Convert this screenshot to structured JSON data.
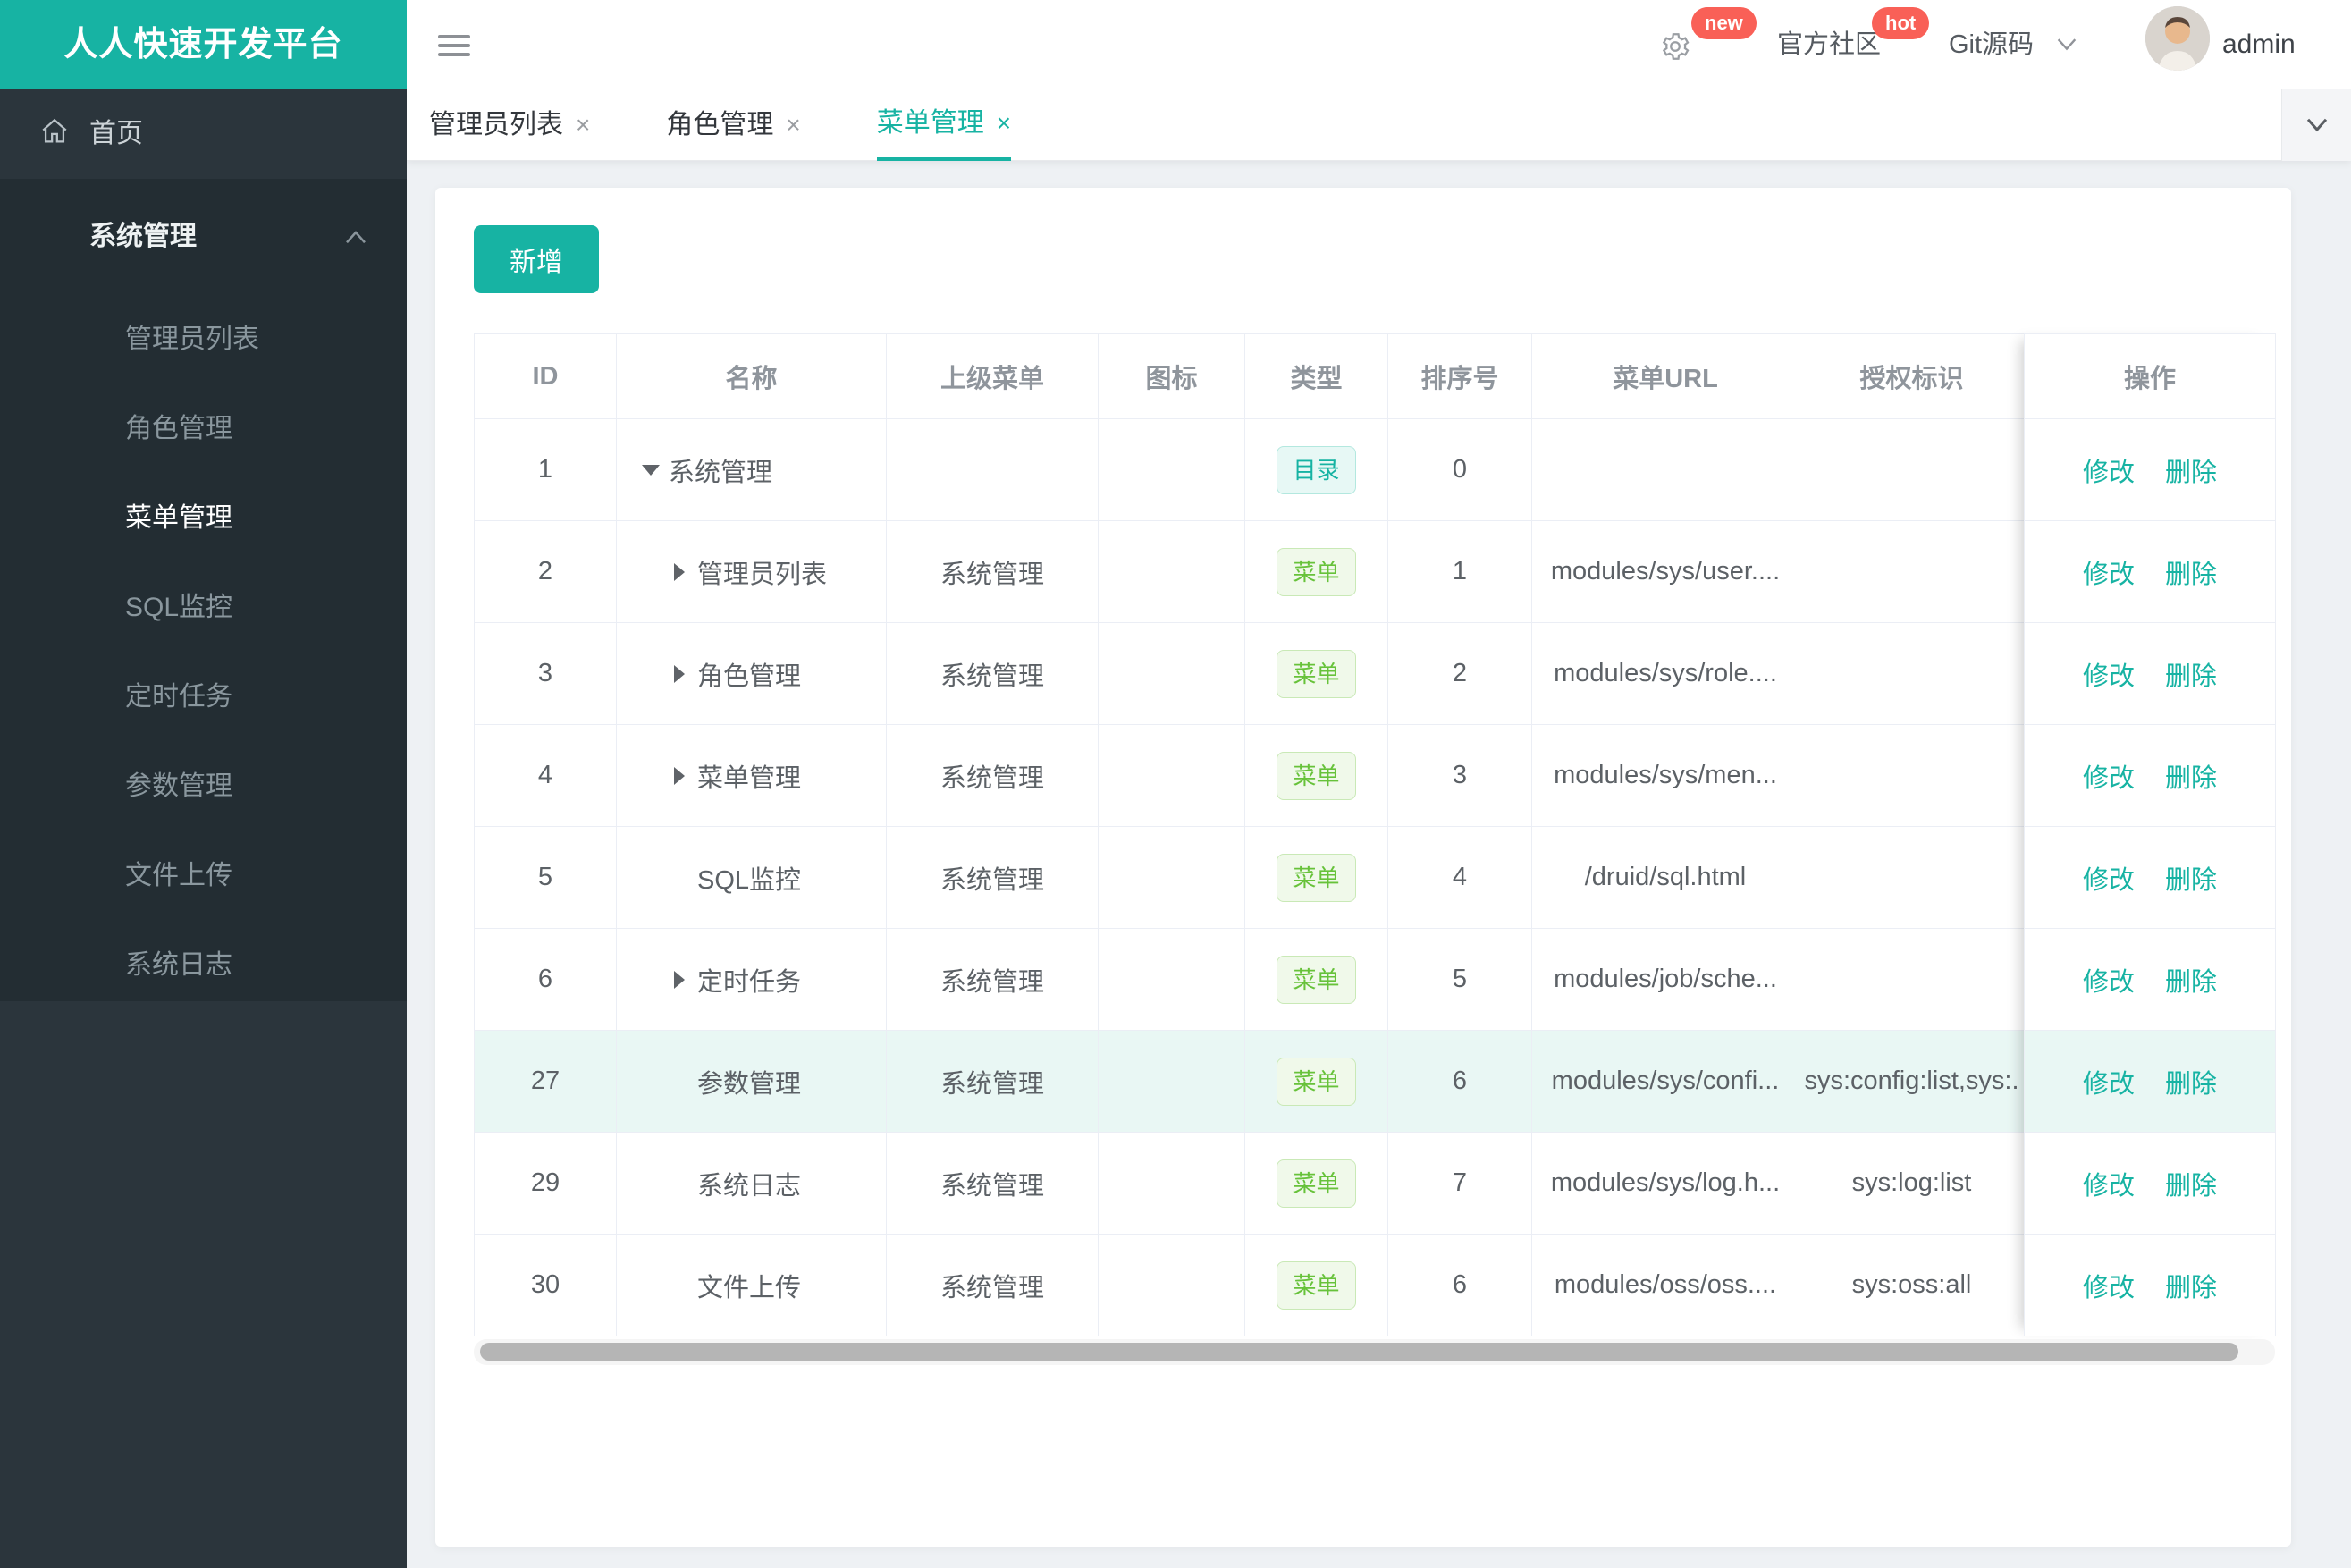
{
  "colors": {
    "accent": "#17b3a3",
    "badge_red": "#f96057",
    "tag_dir_green": "#17b3a3",
    "tag_menu_green": "#67c23a"
  },
  "brand": {
    "title": "人人快速开发平台"
  },
  "header": {
    "new_badge": "new",
    "community": "官方社区",
    "hot_badge": "hot",
    "git": "Git源码",
    "user": "admin"
  },
  "sidebar": {
    "home": "首页",
    "menu": {
      "title": "系统管理",
      "active": "菜单管理",
      "items": [
        "管理员列表",
        "角色管理",
        "菜单管理",
        "SQL监控",
        "定时任务",
        "参数管理",
        "文件上传",
        "系统日志"
      ]
    }
  },
  "tabs": {
    "close_glyph": "×",
    "items": [
      {
        "label": "管理员列表",
        "active": false
      },
      {
        "label": "角色管理",
        "active": false
      },
      {
        "label": "菜单管理",
        "active": true
      }
    ]
  },
  "toolbar": {
    "add_label": "新增"
  },
  "table": {
    "columns": [
      "ID",
      "名称",
      "上级菜单",
      "图标",
      "类型",
      "排序号",
      "菜单URL",
      "授权标识",
      "操作"
    ],
    "type_labels": {
      "dir": "目录",
      "menu": "菜单"
    },
    "ops": {
      "edit": "修改",
      "delete": "删除"
    },
    "rows": [
      {
        "id": "1",
        "caret": "down",
        "level": 0,
        "name": "系统管理",
        "parent": "",
        "icon": "",
        "type": "dir",
        "order": "0",
        "url": "",
        "auth": "",
        "highlight": false
      },
      {
        "id": "2",
        "caret": "right",
        "level": 1,
        "name": "管理员列表",
        "parent": "系统管理",
        "icon": "",
        "type": "menu",
        "order": "1",
        "url": "modules/sys/user....",
        "auth": "",
        "highlight": false
      },
      {
        "id": "3",
        "caret": "right",
        "level": 1,
        "name": "角色管理",
        "parent": "系统管理",
        "icon": "",
        "type": "menu",
        "order": "2",
        "url": "modules/sys/role....",
        "auth": "",
        "highlight": false
      },
      {
        "id": "4",
        "caret": "right",
        "level": 1,
        "name": "菜单管理",
        "parent": "系统管理",
        "icon": "",
        "type": "menu",
        "order": "3",
        "url": "modules/sys/men...",
        "auth": "",
        "highlight": false
      },
      {
        "id": "5",
        "caret": null,
        "level": 1,
        "name": "SQL监控",
        "parent": "系统管理",
        "icon": "",
        "type": "menu",
        "order": "4",
        "url": "/druid/sql.html",
        "auth": "",
        "highlight": false
      },
      {
        "id": "6",
        "caret": "right",
        "level": 1,
        "name": "定时任务",
        "parent": "系统管理",
        "icon": "",
        "type": "menu",
        "order": "5",
        "url": "modules/job/sche...",
        "auth": "",
        "highlight": false
      },
      {
        "id": "27",
        "caret": null,
        "level": 1,
        "name": "参数管理",
        "parent": "系统管理",
        "icon": "",
        "type": "menu",
        "order": "6",
        "url": "modules/sys/confi...",
        "auth": "sys:config:list,sys:.",
        "highlight": true
      },
      {
        "id": "29",
        "caret": null,
        "level": 1,
        "name": "系统日志",
        "parent": "系统管理",
        "icon": "",
        "type": "menu",
        "order": "7",
        "url": "modules/sys/log.h...",
        "auth": "sys:log:list",
        "highlight": false
      },
      {
        "id": "30",
        "caret": null,
        "level": 1,
        "name": "文件上传",
        "parent": "系统管理",
        "icon": "",
        "type": "menu",
        "order": "6",
        "url": "modules/oss/oss....",
        "auth": "sys:oss:all",
        "highlight": false
      }
    ]
  }
}
